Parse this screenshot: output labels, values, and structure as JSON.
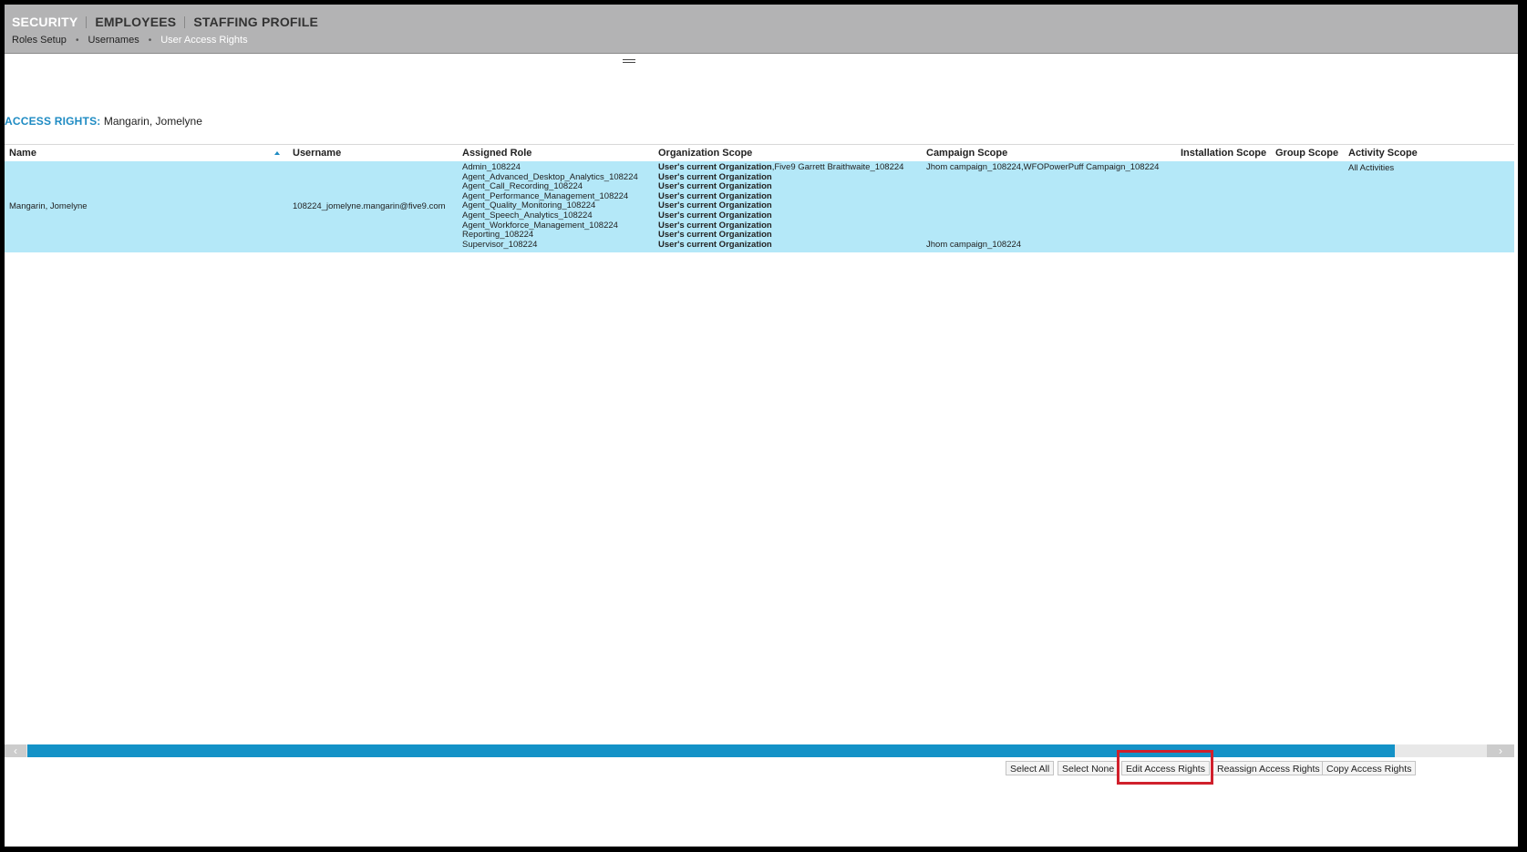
{
  "header": {
    "main_nav": [
      "SECURITY",
      "EMPLOYEES",
      "STAFFING PROFILE"
    ],
    "sub_nav": [
      "Roles Setup",
      "Usernames",
      "User Access Rights"
    ],
    "active_sub": "User Access Rights"
  },
  "access_rights": {
    "label": "ACCESS RIGHTS:",
    "user": "Mangarin, Jomelyne"
  },
  "grid": {
    "columns": [
      "Name",
      "Username",
      "Assigned Role",
      "Organization Scope",
      "Campaign Scope",
      "Installation Scope",
      "Group Scope",
      "Activity Scope"
    ],
    "sort_column": "Name",
    "rows": [
      {
        "name": "Mangarin, Jomelyne",
        "username": "108224_jomelyne.mangarin@five9.com",
        "roles": [
          "Admin_108224",
          "Agent_Advanced_Desktop_Analytics_108224",
          "Agent_Call_Recording_108224",
          "Agent_Performance_Management_108224",
          "Agent_Quality_Monitoring_108224",
          "Agent_Speech_Analytics_108224",
          "Agent_Workforce_Management_108224",
          "Reporting_108224",
          "Supervisor_108224"
        ],
        "org_scope": [
          {
            "bold": "User's current Organization",
            "rest": ",Five9 Garrett Braithwaite_108224"
          },
          {
            "bold": "User's current Organization",
            "rest": ""
          },
          {
            "bold": "User's current Organization",
            "rest": ""
          },
          {
            "bold": "User's current Organization",
            "rest": ""
          },
          {
            "bold": "User's current Organization",
            "rest": ""
          },
          {
            "bold": "User's current Organization",
            "rest": ""
          },
          {
            "bold": "User's current Organization",
            "rest": ""
          },
          {
            "bold": "User's current Organization",
            "rest": ""
          },
          {
            "bold": "User's current Organization",
            "rest": ""
          }
        ],
        "campaign_scope": [
          "Jhom campaign_108224,WFOPowerPuff Campaign_108224",
          "",
          "",
          "",
          "",
          "",
          "",
          "",
          "Jhom campaign_108224"
        ],
        "installation_scope": "",
        "group_scope": "",
        "activity_scope": "All Activities"
      }
    ]
  },
  "buttons": {
    "select_all": "Select All",
    "select_none": "Select None",
    "edit": "Edit Access Rights",
    "reassign": "Reassign Access Rights",
    "copy": "Copy Access Rights"
  },
  "scroll_arrows": {
    "left": "‹",
    "right": "›"
  },
  "colors": {
    "accent": "#1492c7",
    "selected_row": "#b4e8f8",
    "highlight": "#d0202c",
    "header_bg": "#b3b3b4"
  }
}
